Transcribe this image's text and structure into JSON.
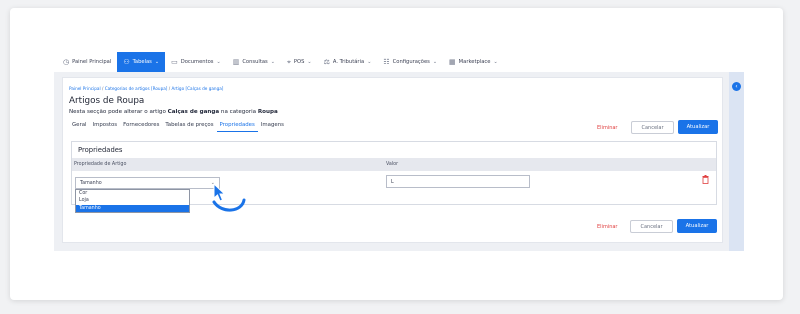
{
  "nav": {
    "items": [
      {
        "icon": "clock-icon",
        "label": "Painel Principal",
        "chevron": false,
        "active": false
      },
      {
        "icon": "users-icon",
        "label": "Tabelas",
        "chevron": true,
        "active": true
      },
      {
        "icon": "document-icon",
        "label": "Documentos",
        "chevron": true,
        "active": false
      },
      {
        "icon": "bar-chart-icon",
        "label": "Consultas",
        "chevron": true,
        "active": false
      },
      {
        "icon": "tag-icon",
        "label": "POS",
        "chevron": true,
        "active": false
      },
      {
        "icon": "scale-icon",
        "label": "A. Tributária",
        "chevron": true,
        "active": false
      },
      {
        "icon": "sliders-icon",
        "label": "Configurações",
        "chevron": true,
        "active": false
      },
      {
        "icon": "grid-icon",
        "label": "Marketplace",
        "chevron": true,
        "active": false
      }
    ]
  },
  "breadcrumb": {
    "items": [
      "Painel Principal",
      "Categorias de artigos [Roupa]",
      "Artigo [Calças de ganga]"
    ]
  },
  "page": {
    "title": "Artigos de Roupa",
    "subtitle_prefix": "Nesta secção pode alterar o artigo ",
    "article": "Calças de ganga",
    "subtitle_middle": " na categoria ",
    "category": "Roupa"
  },
  "tabs": [
    {
      "label": "Geral",
      "active": false
    },
    {
      "label": "Impostos",
      "active": false
    },
    {
      "label": "Fornecedores",
      "active": false
    },
    {
      "label": "Tabelas de preços",
      "active": false
    },
    {
      "label": "Propriedades",
      "active": true
    },
    {
      "label": "Imagens",
      "active": false
    }
  ],
  "actions": {
    "delete": "Eliminar",
    "cancel": "Cancelar",
    "save": "Atualizar"
  },
  "properties": {
    "title": "Propriedades",
    "col_property": "Propriedade de Artigo",
    "col_value": "Valor",
    "selected": "Tamanho",
    "value": "L",
    "options": [
      "Cor",
      "Loja",
      "Tamanho"
    ],
    "highlighted_option": "Tamanho"
  },
  "colors": {
    "accent": "#1a73e8",
    "danger": "#e04040"
  }
}
